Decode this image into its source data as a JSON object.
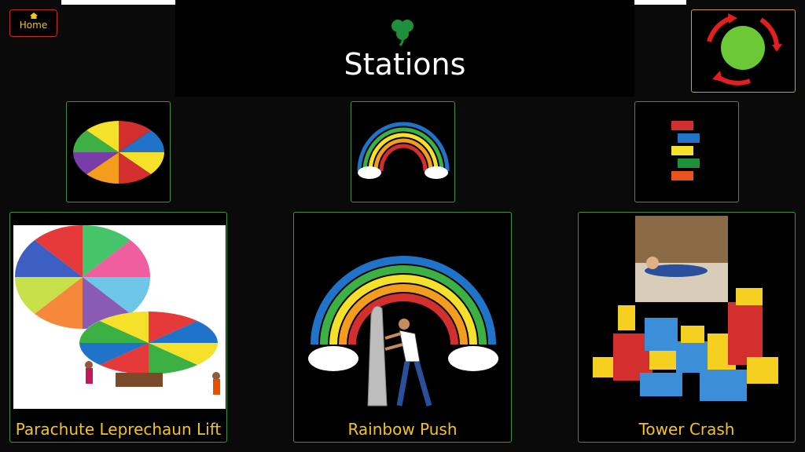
{
  "header": {
    "title": "Stations",
    "home_label": "Home"
  },
  "icons": {
    "home": "home-icon",
    "clover": "shamrock-icon",
    "rotate": "rotate-stations-icon"
  },
  "colors": {
    "background": "#000000",
    "accent_text": "#f5c518",
    "tile_border": "#3f8f3f",
    "home_border": "#c62828",
    "rotate_border": "#c9a227"
  },
  "small_tiles": [
    {
      "name": "parachute",
      "icon": "parachute-icon"
    },
    {
      "name": "rainbow",
      "icon": "rainbow-icon"
    },
    {
      "name": "tower",
      "icon": "stacked-blocks-icon"
    }
  ],
  "stations": [
    {
      "label": "Parachute Leprechaun Lift",
      "picture": "parachute-photo"
    },
    {
      "label": "Rainbow Push",
      "picture": "rainbow-push-illustration"
    },
    {
      "label": "Tower Crash",
      "picture": "tower-crash-photo"
    }
  ]
}
